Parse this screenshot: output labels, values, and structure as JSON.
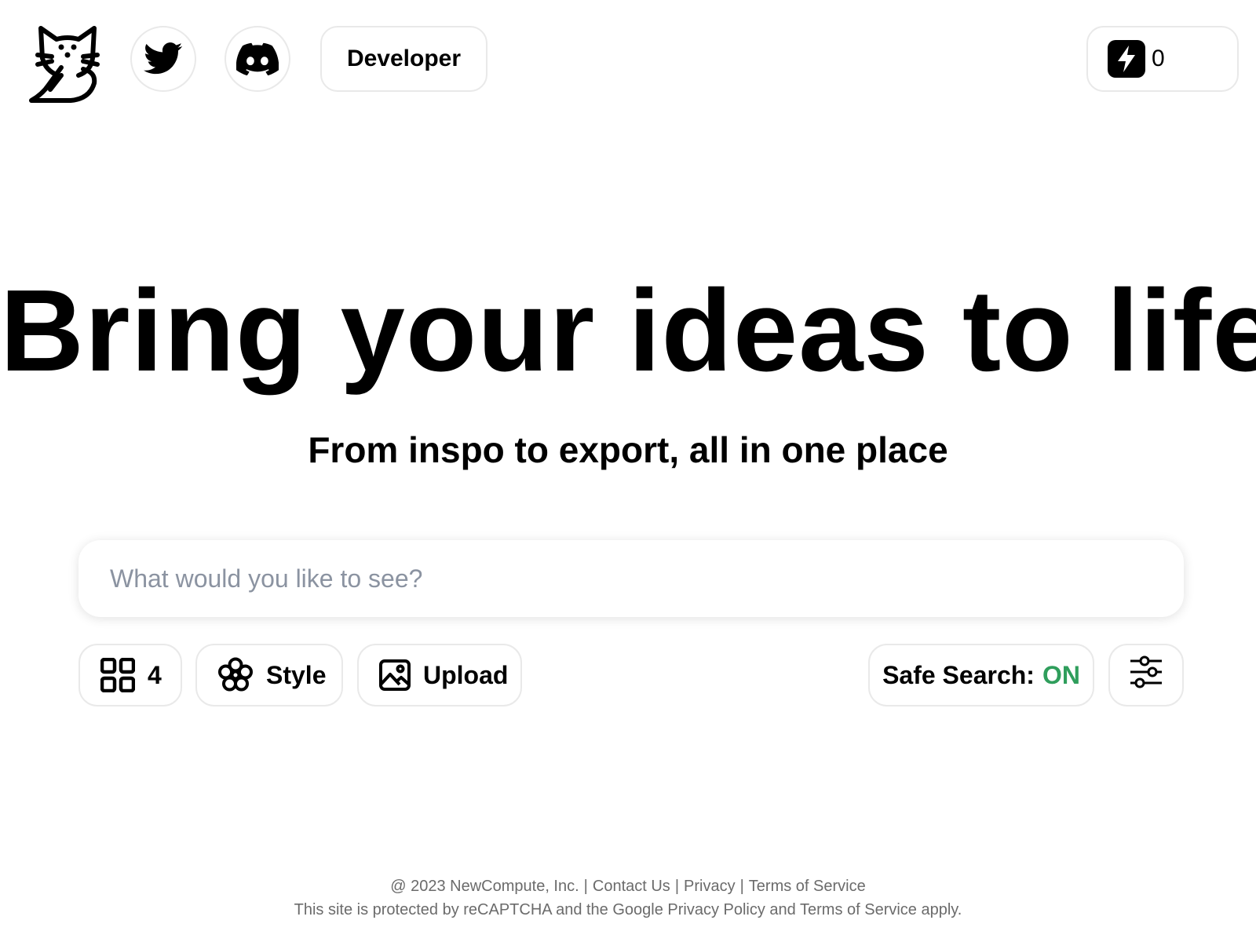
{
  "header": {
    "logo_icon": "cat-logo-icon",
    "social": [
      {
        "icon": "twitter-icon"
      },
      {
        "icon": "discord-icon"
      }
    ],
    "developer_label": "Developer",
    "credits": {
      "icon": "bolt-icon",
      "count": "0"
    }
  },
  "hero": {
    "title": "Bring your ideas to life",
    "subtitle": "From inspo to export, all in one place"
  },
  "prompt": {
    "placeholder": "What would you like to see?",
    "value": ""
  },
  "toolbar": {
    "count": {
      "icon": "grid-icon",
      "label": "4"
    },
    "style": {
      "icon": "flower-icon",
      "label": "Style"
    },
    "upload": {
      "icon": "image-icon",
      "label": "Upload"
    },
    "safe_search": {
      "label": "Safe Search:",
      "state": "ON",
      "state_color": "#2f9e5c"
    },
    "settings": {
      "icon": "sliders-icon"
    }
  },
  "footer": {
    "copyright": "@ 2023 NewCompute, Inc.",
    "separator": "|",
    "contact": "Contact Us",
    "privacy": "Privacy",
    "terms": "Terms of Service",
    "recaptcha_notice": "This site is protected by reCAPTCHA and the Google Privacy Policy and Terms of Service apply."
  }
}
